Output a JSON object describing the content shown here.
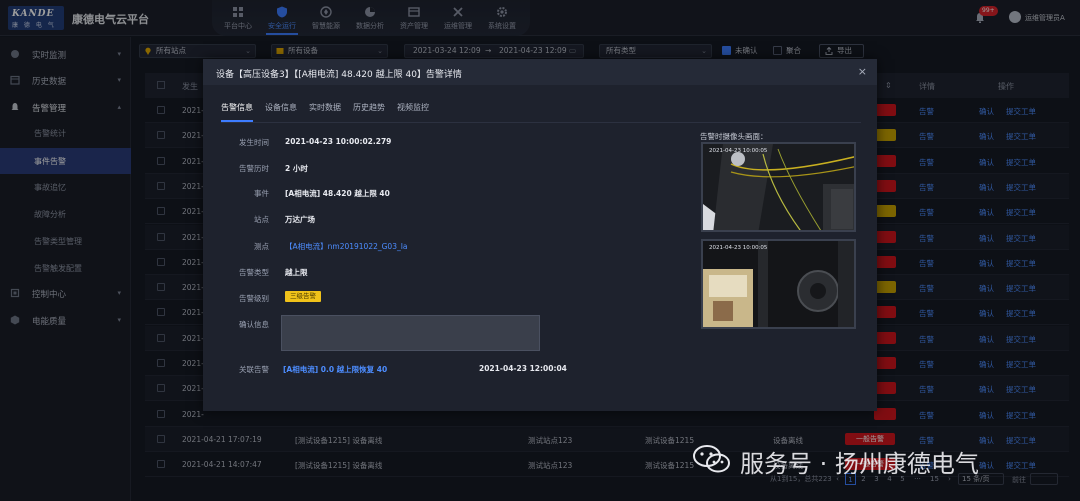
{
  "app": {
    "logo_main": "KANDE",
    "logo_sub": "康 德 电 气",
    "title": "康德电气云平台"
  },
  "nav": [
    {
      "label": "平台中心",
      "icon": "grid-icon"
    },
    {
      "label": "安全运行",
      "icon": "shield-icon",
      "active": true
    },
    {
      "label": "智慧能源",
      "icon": "leaf-icon"
    },
    {
      "label": "数据分析",
      "icon": "pie-chart-icon"
    },
    {
      "label": "资产管理",
      "icon": "asset-icon"
    },
    {
      "label": "运维管理",
      "icon": "tools-icon"
    },
    {
      "label": "系统设置",
      "icon": "gear-icon"
    }
  ],
  "header": {
    "badge": "99+",
    "user": "运维管理员A"
  },
  "sidebar": {
    "items": [
      {
        "label": "实时监测",
        "icon": "monitor-icon"
      },
      {
        "label": "历史数据",
        "icon": "calendar-icon"
      },
      {
        "label": "告警管理",
        "icon": "alarm-icon",
        "open": true
      },
      {
        "label": "控制中心",
        "icon": "power-icon"
      },
      {
        "label": "电能质量",
        "icon": "quality-icon"
      }
    ],
    "sub": [
      {
        "label": "告警统计"
      },
      {
        "label": "事件告警",
        "active": true
      },
      {
        "label": "事故追忆"
      },
      {
        "label": "故障分析"
      },
      {
        "label": "告警类型管理"
      },
      {
        "label": "告警触发配置"
      }
    ]
  },
  "filters": {
    "site": "所有站点",
    "device": "所有设备",
    "date_start": "2021-03-24 12:09",
    "date_end": "2021-04-23 12:09",
    "arrow": "→",
    "type": "所有类型",
    "unconfirmed_label": "未确认",
    "merge_label": "聚合",
    "export_label": "导出"
  },
  "table": {
    "headers": {
      "time": "发生",
      "sort_icon": "⇕",
      "detail": "详情",
      "action": "操作"
    },
    "row_detail": "告警",
    "row_confirm": "确认",
    "row_submit": "提交工单",
    "levels": [
      "red",
      "yellow",
      "red",
      "red",
      "yellow",
      "red",
      "red",
      "yellow",
      "red",
      "red",
      "red",
      "red",
      "red"
    ],
    "time_prefix": "2021-",
    "visible_rows": [
      {
        "time": "2021-04-21 17:07:19",
        "event": "[测试设备1215] 设备离线",
        "site": "测试站点123",
        "device": "测试设备1215",
        "type": "设备离线",
        "level": "一般告警",
        "detail": "告警",
        "confirm": "确认",
        "submit": "提交工单"
      },
      {
        "time": "2021-04-21 14:07:47",
        "event": "[测试设备1215] 设备离线",
        "site": "测试站点123",
        "device": "测试设备1215",
        "type": "设备离线",
        "level": "一般告警",
        "detail": "告警",
        "confirm": "确认",
        "submit": "提交工单"
      }
    ]
  },
  "pager": {
    "summary": "从1到15，总共223",
    "prev": "‹",
    "pages": [
      "1",
      "2",
      "3",
      "4",
      "5"
    ],
    "ellipsis": "···",
    "last": "15",
    "next": "›",
    "size": "15 条/页",
    "jump": "前往"
  },
  "modal": {
    "title": "设备【高压设备3】【[A相电流] 48.420 越上限 40】告警详情",
    "close": "×",
    "tabs": [
      "告警信息",
      "设备信息",
      "实时数据",
      "历史趋势",
      "视频监控"
    ],
    "fields": {
      "time_label": "发生时间",
      "time": "2021-04-23 10:00:02.279",
      "duration_label": "告警历时",
      "duration": "2 小时",
      "event_label": "事件",
      "event": "[A相电流] 48.420 越上限 40",
      "site_label": "站点",
      "site": "万达广场",
      "point_label": "测点",
      "point": "【A相电流】nm20191022_G03_Ia",
      "type_label": "告警类型",
      "type": "越上限",
      "level_label": "告警级别",
      "level": "三级告警",
      "confirm_label": "确认信息",
      "related_label": "关联告警",
      "related": "[A相电流] 0.0 越上限恢复 40",
      "related_time": "2021-04-23 12:00:04"
    },
    "camera": {
      "title": "告警时摄像头画面：",
      "ts1": "2021-04-23  10:00:05",
      "ts2": "2021-04-23  10:00:05"
    }
  },
  "watermark": {
    "text": "服务号 · 扬州康德电气"
  }
}
